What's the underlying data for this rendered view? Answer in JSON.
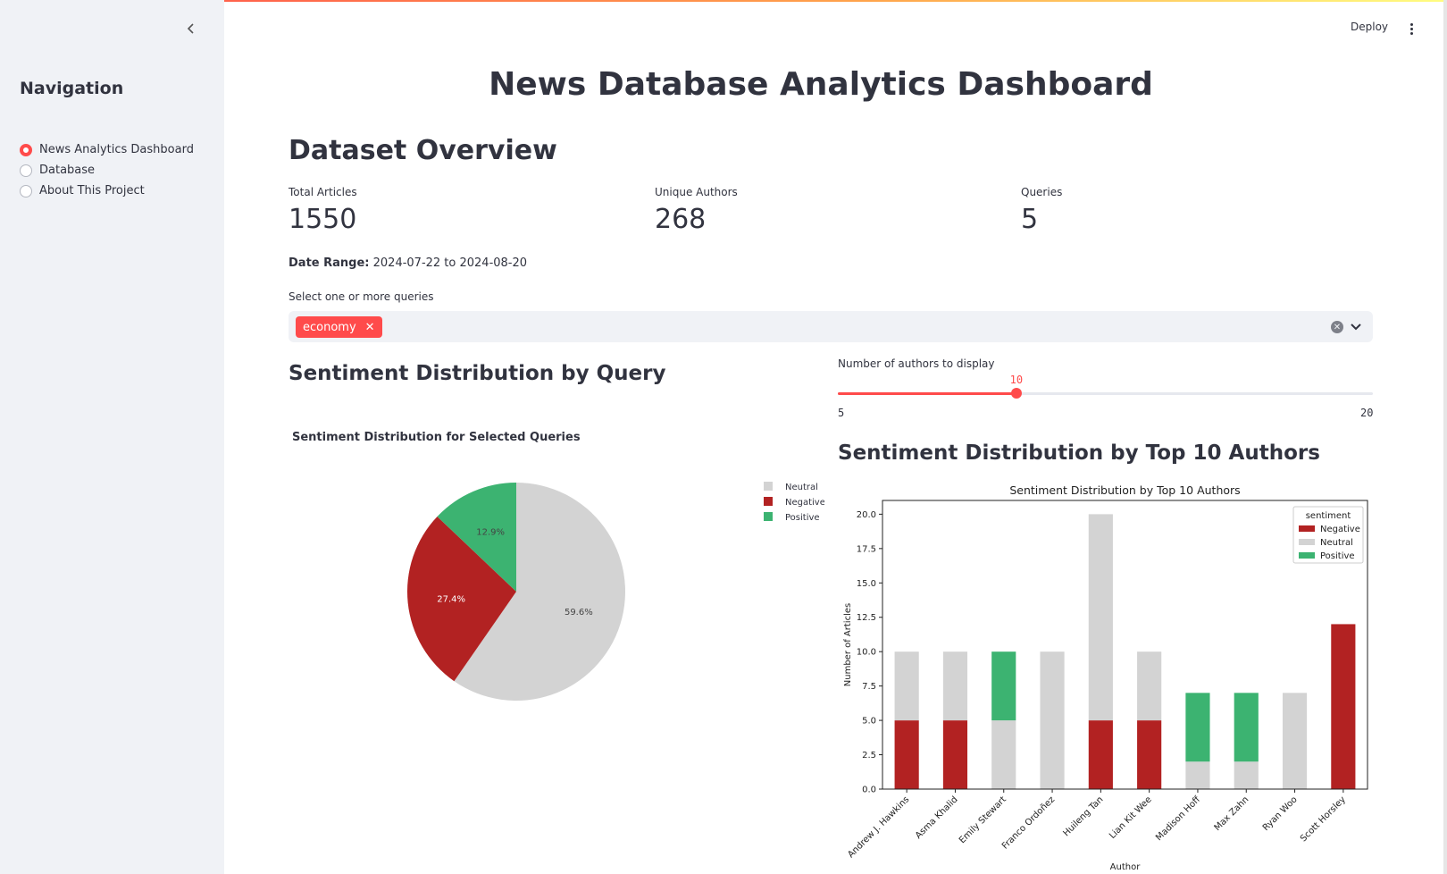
{
  "sidebar": {
    "nav_title": "Navigation",
    "items": [
      {
        "label": "News Analytics Dashboard",
        "selected": true
      },
      {
        "label": "Database",
        "selected": false
      },
      {
        "label": "About This Project",
        "selected": false
      }
    ]
  },
  "header": {
    "deploy_label": "Deploy"
  },
  "main": {
    "title": "News Database Analytics Dashboard",
    "overview_heading": "Dataset Overview",
    "metrics": [
      {
        "label": "Total Articles",
        "value": "1550"
      },
      {
        "label": "Unique Authors",
        "value": "268"
      },
      {
        "label": "Queries",
        "value": "5"
      }
    ],
    "date_range_label": "Date Range:",
    "date_range_value": "2024-07-22 to 2024-08-20",
    "query_select": {
      "label": "Select one or more queries",
      "selected": [
        "economy"
      ]
    },
    "sentiment_query_heading": "Sentiment Distribution by Query",
    "authors_slider": {
      "label": "Number of authors to display",
      "value": 10,
      "min": 5,
      "max": 20
    },
    "authors_heading": "Sentiment Distribution by Top 10 Authors"
  },
  "colors": {
    "negative": "#b22222",
    "neutral": "#d3d3d3",
    "positive": "#3cb371",
    "accent": "#ff4b4b"
  },
  "chart_data": [
    {
      "type": "pie",
      "title": "Sentiment Distribution for Selected Queries",
      "labels": [
        "Neutral",
        "Negative",
        "Positive"
      ],
      "values": [
        59.6,
        27.4,
        12.9
      ],
      "data_labels": [
        "59.6%",
        "27.4%",
        "12.9%"
      ],
      "legend": "right"
    },
    {
      "type": "bar",
      "stacked": true,
      "title": "Sentiment Distribution by Top 10 Authors",
      "xlabel": "Author",
      "ylabel": "Number of Articles",
      "categories": [
        "Andrew J. Hawkins",
        "Asma Khalid",
        "Emily Stewart",
        "Franco Ordoñez",
        "Huileng Tan",
        "Lian Kit Wee",
        "Madison Hoff",
        "Max Zahn",
        "Ryan Woo",
        "Scott Horsley"
      ],
      "series": [
        {
          "name": "Negative",
          "values": [
            5,
            5,
            0,
            0,
            5,
            5,
            0,
            0,
            0,
            12
          ]
        },
        {
          "name": "Neutral",
          "values": [
            5,
            5,
            5,
            10,
            15,
            5,
            2,
            2,
            7,
            0
          ]
        },
        {
          "name": "Positive",
          "values": [
            0,
            0,
            5,
            0,
            0,
            0,
            5,
            5,
            0,
            0
          ]
        }
      ],
      "ylim": [
        0,
        21
      ],
      "yticks": [
        "0.0",
        "2.5",
        "5.0",
        "7.5",
        "10.0",
        "12.5",
        "15.0",
        "17.5",
        "20.0"
      ],
      "legend_title": "sentiment",
      "legend": "top-right",
      "grid": false
    }
  ]
}
